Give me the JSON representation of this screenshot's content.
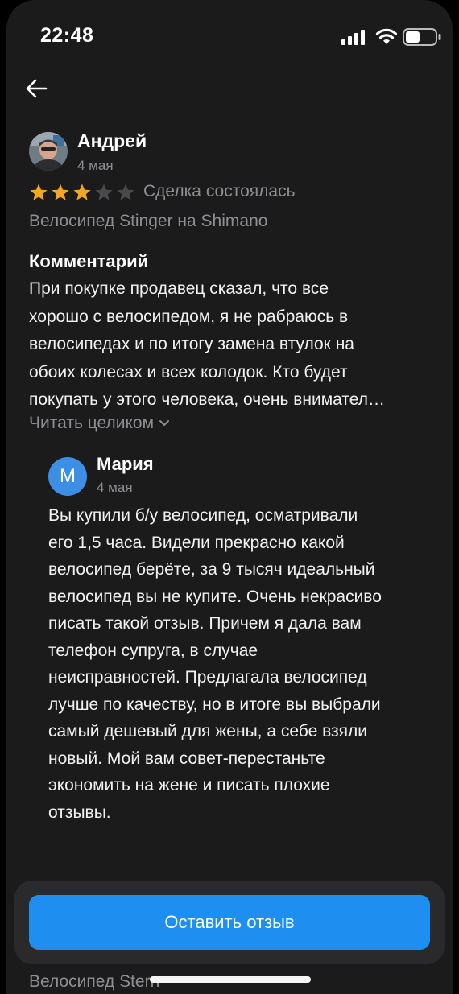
{
  "status_bar": {
    "time": "22:48"
  },
  "review": {
    "author": "Андрей",
    "date": "4 мая",
    "rating": 3,
    "rating_max": 5,
    "deal_status": "Сделка состоялась",
    "product": "Велосипед Stinger на Shimano",
    "comment_title": "Комментарий",
    "comment_lines": [
      "При покупке продавец сказал, что все",
      "хорошо с велосипедом, я не рабраюсь в",
      "велосипедах и по итогу замена втулок на",
      "обоих колесах и всех колодок. Кто будет",
      "покупать у этого человека, очень внимател…"
    ],
    "read_more": "Читать целиком"
  },
  "reply": {
    "avatar_letter": "М",
    "author": "Мария",
    "date": "4 мая",
    "text_lines": [
      "Вы купили б/у велосипед, осматривали",
      "его 1,5 часа. Видели прекрасно какой",
      "велосипед берёте, за 9 тысяч идеальный",
      "велосипед вы не купите. Очень некрасиво",
      "писать такой отзыв. Причем я дала вам",
      "телефон супруга, в случае",
      "неисправностей. Предлагала велосипед",
      "лучше по качеству, но в итоге вы выбрали",
      "самый дешевый для жены, а себе взяли",
      "новый. Мой вам совет-перестаньте",
      "экономить на жене и писать плохие",
      "отзывы."
    ]
  },
  "footer": {
    "leave_review": "Оставить отзыв",
    "next_item_partial": "Велосипед Stern"
  },
  "colors": {
    "accent": "#1e8ef0",
    "star": "#f5a623",
    "star_empty": "#4a4a4c",
    "background": "#1b1b1c"
  },
  "icons": [
    "arrow-left-icon",
    "signal-icon",
    "wifi-icon",
    "battery-icon",
    "star-icon",
    "chevron-down-icon"
  ]
}
